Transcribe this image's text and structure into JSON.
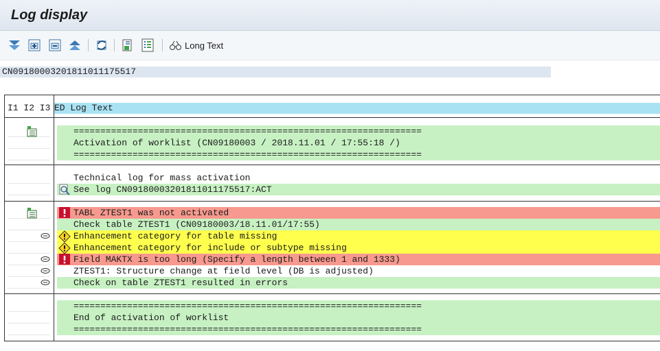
{
  "window": {
    "title": "Log display"
  },
  "toolbar": {
    "icons": [
      "expand-all-icon",
      "expand-node-icon",
      "collapse-node-icon",
      "collapse-all-icon",
      "refresh-icon",
      "select-icon",
      "list-icon",
      "long-text-icon"
    ],
    "long_text_label": "Long Text"
  },
  "log_id": "CN09180003201811011175517",
  "grid": {
    "header_left": "I1 I2 I3",
    "header_text": "ED Log Text",
    "rows": [
      {
        "text": "=================================================================",
        "color": "#c7f1c3"
      },
      {
        "text": "Activation of worklist (CN09180003 / 2018.11.01 / 17:55:18 /)",
        "color": "#c7f1c3"
      },
      {
        "text": "=================================================================",
        "color": "#c7f1c3"
      },
      {
        "text": "Technical log for mass activation",
        "color": "#ffffff"
      },
      {
        "text": "See log CN09180003201811011175517:ACT",
        "color": "#c7f1c3"
      },
      {
        "text": "TABL ZTEST1 was not activated",
        "color": "#f7998e"
      },
      {
        "text": "Check table ZTEST1 (CN09180003/18.11.01/17:55)",
        "color": "#c7f1c3"
      },
      {
        "text": "Enhancement category for table missing",
        "color": "#ffff4d"
      },
      {
        "text": "Enhancement category for include or subtype missing",
        "color": "#ffff4d"
      },
      {
        "text": "Field MAKTX is too long (Specify a length between 1 and 1333)",
        "color": "#f7998e"
      },
      {
        "text": "ZTEST1: Structure change at field level (DB is adjusted)",
        "color": "#ffffff"
      },
      {
        "text": "Check on table ZTEST1 resulted in errors",
        "color": "#c7f1c3"
      },
      {
        "text": "=================================================================",
        "color": "#c7f1c3"
      },
      {
        "text": "End of activation of worklist",
        "color": "#c7f1c3"
      },
      {
        "text": "=================================================================",
        "color": "#c7f1c3"
      }
    ]
  }
}
